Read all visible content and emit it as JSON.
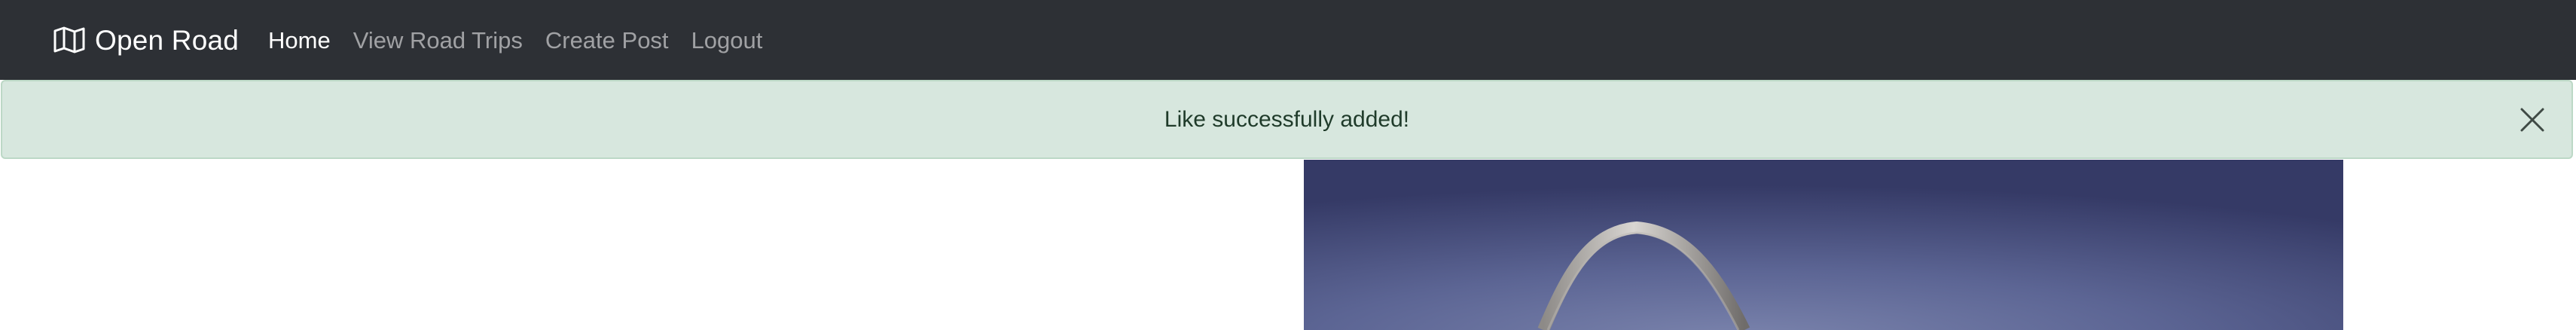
{
  "navbar": {
    "brand": {
      "icon": "map-icon",
      "label": "Open Road"
    },
    "links": [
      {
        "label": "Home",
        "active": true
      },
      {
        "label": "View Road Trips",
        "active": false
      },
      {
        "label": "Create Post",
        "active": false
      },
      {
        "label": "Logout",
        "active": false
      }
    ]
  },
  "alert": {
    "message": "Like successfully added!",
    "close_icon": "close-icon",
    "type": "success"
  },
  "content": {
    "image_subject": "Gateway Arch"
  },
  "colors": {
    "navbar_bg": "#2d3035",
    "alert_bg": "#d7e7de",
    "alert_border": "#bcd8c6",
    "alert_text": "#1f3b2a",
    "nav_link_active": "#ffffff",
    "nav_link_inactive": "#a8a9ab",
    "sky_dark": "#3b3f6b",
    "sky_light": "#6f78a3"
  }
}
